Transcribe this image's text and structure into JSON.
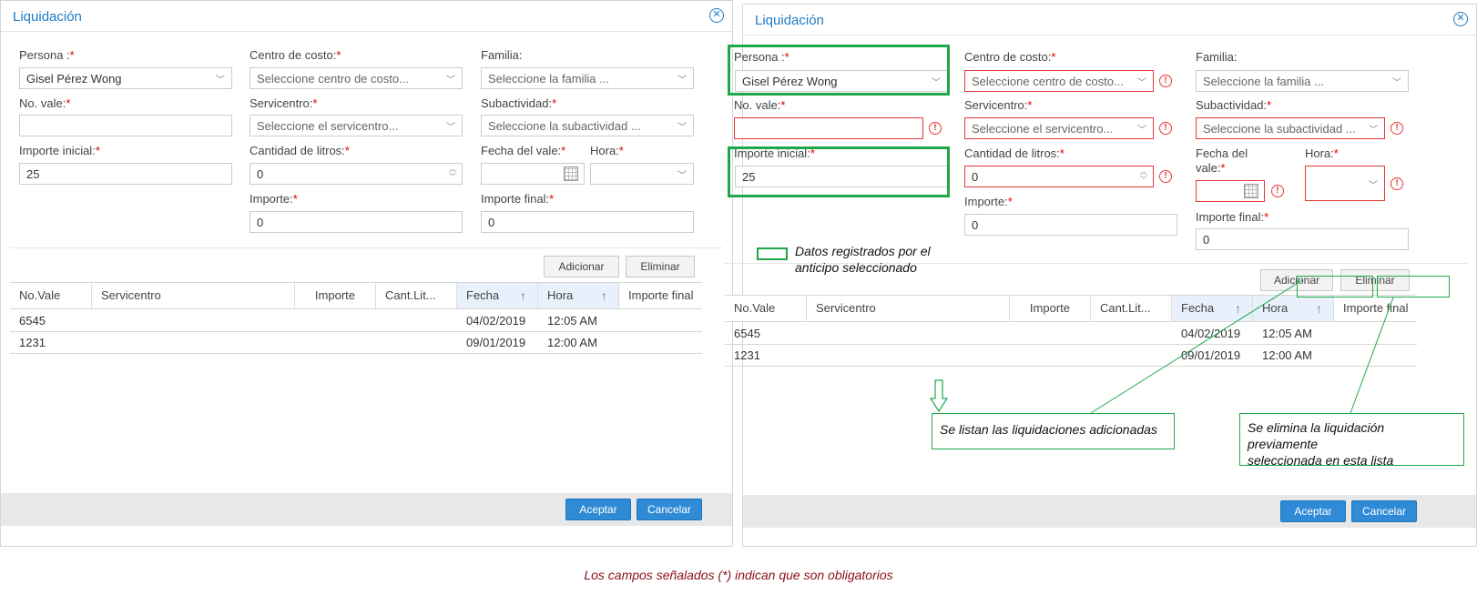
{
  "left": {
    "title": "Liquidación",
    "persona_label": "Persona :",
    "persona_value": "Gisel Pérez Wong",
    "centro_label": "Centro de costo:",
    "centro_placeholder": "Seleccione centro de costo...",
    "familia_label": "Familia:",
    "familia_placeholder": "Seleccione la familia ...",
    "vale_label": "No. vale:",
    "vale_value": "",
    "servicentro_label": "Servicentro:",
    "servicentro_placeholder": "Seleccione el servicentro...",
    "subactividad_label": "Subactividad:",
    "subactividad_placeholder": "Seleccione la subactividad ...",
    "importe_inicial_label": "Importe inicial:",
    "importe_inicial_value": "25",
    "litros_label": "Cantidad de litros:",
    "litros_value": "0",
    "fecha_label": "Fecha del vale:",
    "hora_label": "Hora:",
    "importe_label": "Importe:",
    "importe_value": "0",
    "importe_final_label": "Importe final:",
    "importe_final_value": "0",
    "add_label": "Adicionar",
    "delete_label": "Eliminar",
    "columns": [
      "No.Vale",
      "Servicentro",
      "Importe",
      "Cant.Lit...",
      "Fecha",
      "Hora",
      "Importe final"
    ],
    "rows": [
      {
        "vale": "6545",
        "fecha": "04/02/2019",
        "hora": "12:05 AM"
      },
      {
        "vale": "1231",
        "fecha": "09/01/2019",
        "hora": "12:00 AM"
      }
    ],
    "accept_label": "Aceptar",
    "cancel_label": "Cancelar"
  },
  "right": {
    "title": "Liquidación",
    "persona_label": "Persona :",
    "persona_value": "Gisel Pérez Wong",
    "centro_label": "Centro de costo:",
    "centro_placeholder": "Seleccione centro de costo...",
    "familia_label": "Familia:",
    "familia_placeholder": "Seleccione la familia ...",
    "vale_label": "No. vale:",
    "servicentro_label": "Servicentro:",
    "servicentro_placeholder": "Seleccione el servicentro...",
    "subactividad_label": "Subactividad:",
    "subactividad_placeholder": "Seleccione la subactividad ...",
    "importe_inicial_label": "Importe inicial:",
    "importe_inicial_value": "25",
    "litros_label": "Cantidad de litros:",
    "litros_value": "0",
    "fecha_label_1": "Fecha del",
    "fecha_label_2": "vale:",
    "hora_label": "Hora:",
    "importe_label": "Importe:",
    "importe_value": "0",
    "importe_final_label": "Importe final:",
    "importe_final_value": "0",
    "add_label": "Adicionar",
    "delete_label": "Eliminar",
    "columns": [
      "No.Vale",
      "Servicentro",
      "Importe",
      "Cant.Lit...",
      "Fecha",
      "Hora",
      "Importe final"
    ],
    "rows": [
      {
        "vale": "6545",
        "fecha": "04/02/2019",
        "hora": "12:05 AM"
      },
      {
        "vale": "1231",
        "fecha": "09/01/2019",
        "hora": "12:00 AM"
      }
    ],
    "accept_label": "Aceptar",
    "cancel_label": "Cancelar"
  },
  "annotations": {
    "legend_1": "Datos registrados por el",
    "legend_2": "anticipo seleccionado",
    "note_list": "Se listan las liquidaciones adicionadas",
    "note_delete_1": "Se elimina la liquidación previamente",
    "note_delete_2": "seleccionada en esta lista",
    "footnote": "Los campos señalados (*) indican que son obligatorios"
  },
  "colors": {
    "accent": "#1e7bc6",
    "error": "#e53935",
    "highlight": "#1ea84a",
    "primary_button": "#2f8bd6"
  }
}
